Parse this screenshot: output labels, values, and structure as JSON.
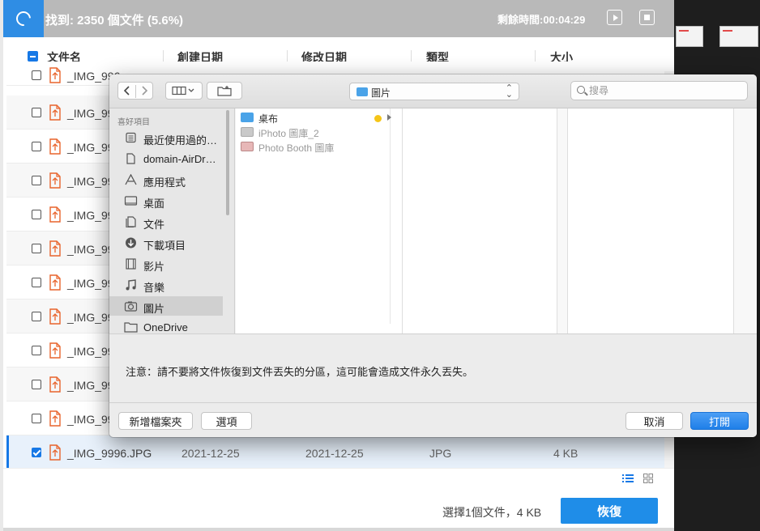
{
  "scan": {
    "found": "找到: 2350 個文件 (5.6%)",
    "remaining": "剩餘時間:00:04:29"
  },
  "columns": {
    "name": "文件名",
    "created": "創建日期",
    "modified": "修改日期",
    "type": "類型",
    "size": "大小"
  },
  "rows": [
    {
      "name": "_IMG_996"
    },
    {
      "name": "_IMG_99"
    },
    {
      "name": "_IMG_99"
    },
    {
      "name": "_IMG_99"
    },
    {
      "name": "_IMG_99"
    },
    {
      "name": "_IMG_99"
    },
    {
      "name": "_IMG_99"
    },
    {
      "name": "_IMG_99"
    },
    {
      "name": "_IMG_99"
    },
    {
      "name": "_IMG_99"
    },
    {
      "name": "_IMG_99"
    },
    {
      "name": "_IMG_9996.JPG",
      "created": "2021-12-25",
      "modified": "2021-12-25",
      "type": "JPG",
      "size": "4 KB",
      "selected": true
    }
  ],
  "footer": {
    "selection": "選擇1個文件，4 KB",
    "recover": "恢復"
  },
  "dialog": {
    "path": "圖片",
    "search_placeholder": "搜尋",
    "sidebar_section": "喜好項目",
    "sidebar": [
      {
        "label": "最近使用過的…",
        "icon": "recents-icon"
      },
      {
        "label": "domain-AirDr…",
        "icon": "document-icon"
      },
      {
        "label": "應用程式",
        "icon": "applications-icon"
      },
      {
        "label": "桌面",
        "icon": "desktop-icon"
      },
      {
        "label": "文件",
        "icon": "documents-icon"
      },
      {
        "label": "下載項目",
        "icon": "downloads-icon"
      },
      {
        "label": "影片",
        "icon": "movies-icon"
      },
      {
        "label": "音樂",
        "icon": "music-icon"
      },
      {
        "label": "圖片",
        "icon": "pictures-icon",
        "selected": true
      },
      {
        "label": "OneDrive",
        "icon": "folder-icon"
      }
    ],
    "files": [
      {
        "label": "桌布",
        "icon": "folder-icon",
        "dim": false,
        "tag_color": "#f5c518"
      },
      {
        "label": "iPhoto 圖庫_2",
        "icon": "iphoto-library-icon",
        "dim": true
      },
      {
        "label": "Photo Booth 圖庫",
        "icon": "photo-booth-library-icon",
        "dim": true
      }
    ],
    "notice": "注意：請不要將文件恢復到文件丟失的分區，這可能會造成文件永久丟失。",
    "new_folder": "新增檔案夾",
    "options": "選項",
    "cancel": "取消",
    "open": "打開"
  },
  "colors": {
    "accent": "#1678e6",
    "topbar": "#b9b9b9",
    "recover_button": "#1f8de8",
    "file_icon": "#e8632b"
  }
}
